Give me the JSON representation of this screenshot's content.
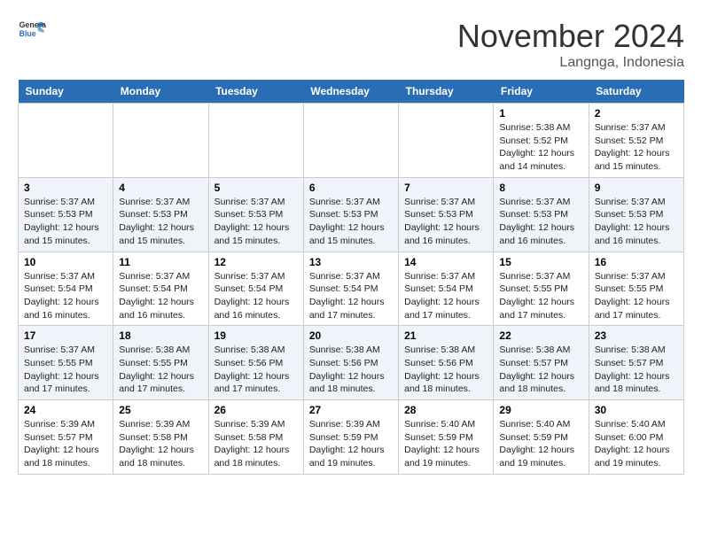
{
  "header": {
    "logo_line1": "General",
    "logo_line2": "Blue",
    "month": "November 2024",
    "location": "Langnga, Indonesia"
  },
  "days_of_week": [
    "Sunday",
    "Monday",
    "Tuesday",
    "Wednesday",
    "Thursday",
    "Friday",
    "Saturday"
  ],
  "weeks": [
    [
      {
        "day": "",
        "info": ""
      },
      {
        "day": "",
        "info": ""
      },
      {
        "day": "",
        "info": ""
      },
      {
        "day": "",
        "info": ""
      },
      {
        "day": "",
        "info": ""
      },
      {
        "day": "1",
        "info": "Sunrise: 5:38 AM\nSunset: 5:52 PM\nDaylight: 12 hours\nand 14 minutes."
      },
      {
        "day": "2",
        "info": "Sunrise: 5:37 AM\nSunset: 5:52 PM\nDaylight: 12 hours\nand 15 minutes."
      }
    ],
    [
      {
        "day": "3",
        "info": "Sunrise: 5:37 AM\nSunset: 5:53 PM\nDaylight: 12 hours\nand 15 minutes."
      },
      {
        "day": "4",
        "info": "Sunrise: 5:37 AM\nSunset: 5:53 PM\nDaylight: 12 hours\nand 15 minutes."
      },
      {
        "day": "5",
        "info": "Sunrise: 5:37 AM\nSunset: 5:53 PM\nDaylight: 12 hours\nand 15 minutes."
      },
      {
        "day": "6",
        "info": "Sunrise: 5:37 AM\nSunset: 5:53 PM\nDaylight: 12 hours\nand 15 minutes."
      },
      {
        "day": "7",
        "info": "Sunrise: 5:37 AM\nSunset: 5:53 PM\nDaylight: 12 hours\nand 16 minutes."
      },
      {
        "day": "8",
        "info": "Sunrise: 5:37 AM\nSunset: 5:53 PM\nDaylight: 12 hours\nand 16 minutes."
      },
      {
        "day": "9",
        "info": "Sunrise: 5:37 AM\nSunset: 5:53 PM\nDaylight: 12 hours\nand 16 minutes."
      }
    ],
    [
      {
        "day": "10",
        "info": "Sunrise: 5:37 AM\nSunset: 5:54 PM\nDaylight: 12 hours\nand 16 minutes."
      },
      {
        "day": "11",
        "info": "Sunrise: 5:37 AM\nSunset: 5:54 PM\nDaylight: 12 hours\nand 16 minutes."
      },
      {
        "day": "12",
        "info": "Sunrise: 5:37 AM\nSunset: 5:54 PM\nDaylight: 12 hours\nand 16 minutes."
      },
      {
        "day": "13",
        "info": "Sunrise: 5:37 AM\nSunset: 5:54 PM\nDaylight: 12 hours\nand 17 minutes."
      },
      {
        "day": "14",
        "info": "Sunrise: 5:37 AM\nSunset: 5:54 PM\nDaylight: 12 hours\nand 17 minutes."
      },
      {
        "day": "15",
        "info": "Sunrise: 5:37 AM\nSunset: 5:55 PM\nDaylight: 12 hours\nand 17 minutes."
      },
      {
        "day": "16",
        "info": "Sunrise: 5:37 AM\nSunset: 5:55 PM\nDaylight: 12 hours\nand 17 minutes."
      }
    ],
    [
      {
        "day": "17",
        "info": "Sunrise: 5:37 AM\nSunset: 5:55 PM\nDaylight: 12 hours\nand 17 minutes."
      },
      {
        "day": "18",
        "info": "Sunrise: 5:38 AM\nSunset: 5:55 PM\nDaylight: 12 hours\nand 17 minutes."
      },
      {
        "day": "19",
        "info": "Sunrise: 5:38 AM\nSunset: 5:56 PM\nDaylight: 12 hours\nand 17 minutes."
      },
      {
        "day": "20",
        "info": "Sunrise: 5:38 AM\nSunset: 5:56 PM\nDaylight: 12 hours\nand 18 minutes."
      },
      {
        "day": "21",
        "info": "Sunrise: 5:38 AM\nSunset: 5:56 PM\nDaylight: 12 hours\nand 18 minutes."
      },
      {
        "day": "22",
        "info": "Sunrise: 5:38 AM\nSunset: 5:57 PM\nDaylight: 12 hours\nand 18 minutes."
      },
      {
        "day": "23",
        "info": "Sunrise: 5:38 AM\nSunset: 5:57 PM\nDaylight: 12 hours\nand 18 minutes."
      }
    ],
    [
      {
        "day": "24",
        "info": "Sunrise: 5:39 AM\nSunset: 5:57 PM\nDaylight: 12 hours\nand 18 minutes."
      },
      {
        "day": "25",
        "info": "Sunrise: 5:39 AM\nSunset: 5:58 PM\nDaylight: 12 hours\nand 18 minutes."
      },
      {
        "day": "26",
        "info": "Sunrise: 5:39 AM\nSunset: 5:58 PM\nDaylight: 12 hours\nand 18 minutes."
      },
      {
        "day": "27",
        "info": "Sunrise: 5:39 AM\nSunset: 5:59 PM\nDaylight: 12 hours\nand 19 minutes."
      },
      {
        "day": "28",
        "info": "Sunrise: 5:40 AM\nSunset: 5:59 PM\nDaylight: 12 hours\nand 19 minutes."
      },
      {
        "day": "29",
        "info": "Sunrise: 5:40 AM\nSunset: 5:59 PM\nDaylight: 12 hours\nand 19 minutes."
      },
      {
        "day": "30",
        "info": "Sunrise: 5:40 AM\nSunset: 6:00 PM\nDaylight: 12 hours\nand 19 minutes."
      }
    ]
  ]
}
